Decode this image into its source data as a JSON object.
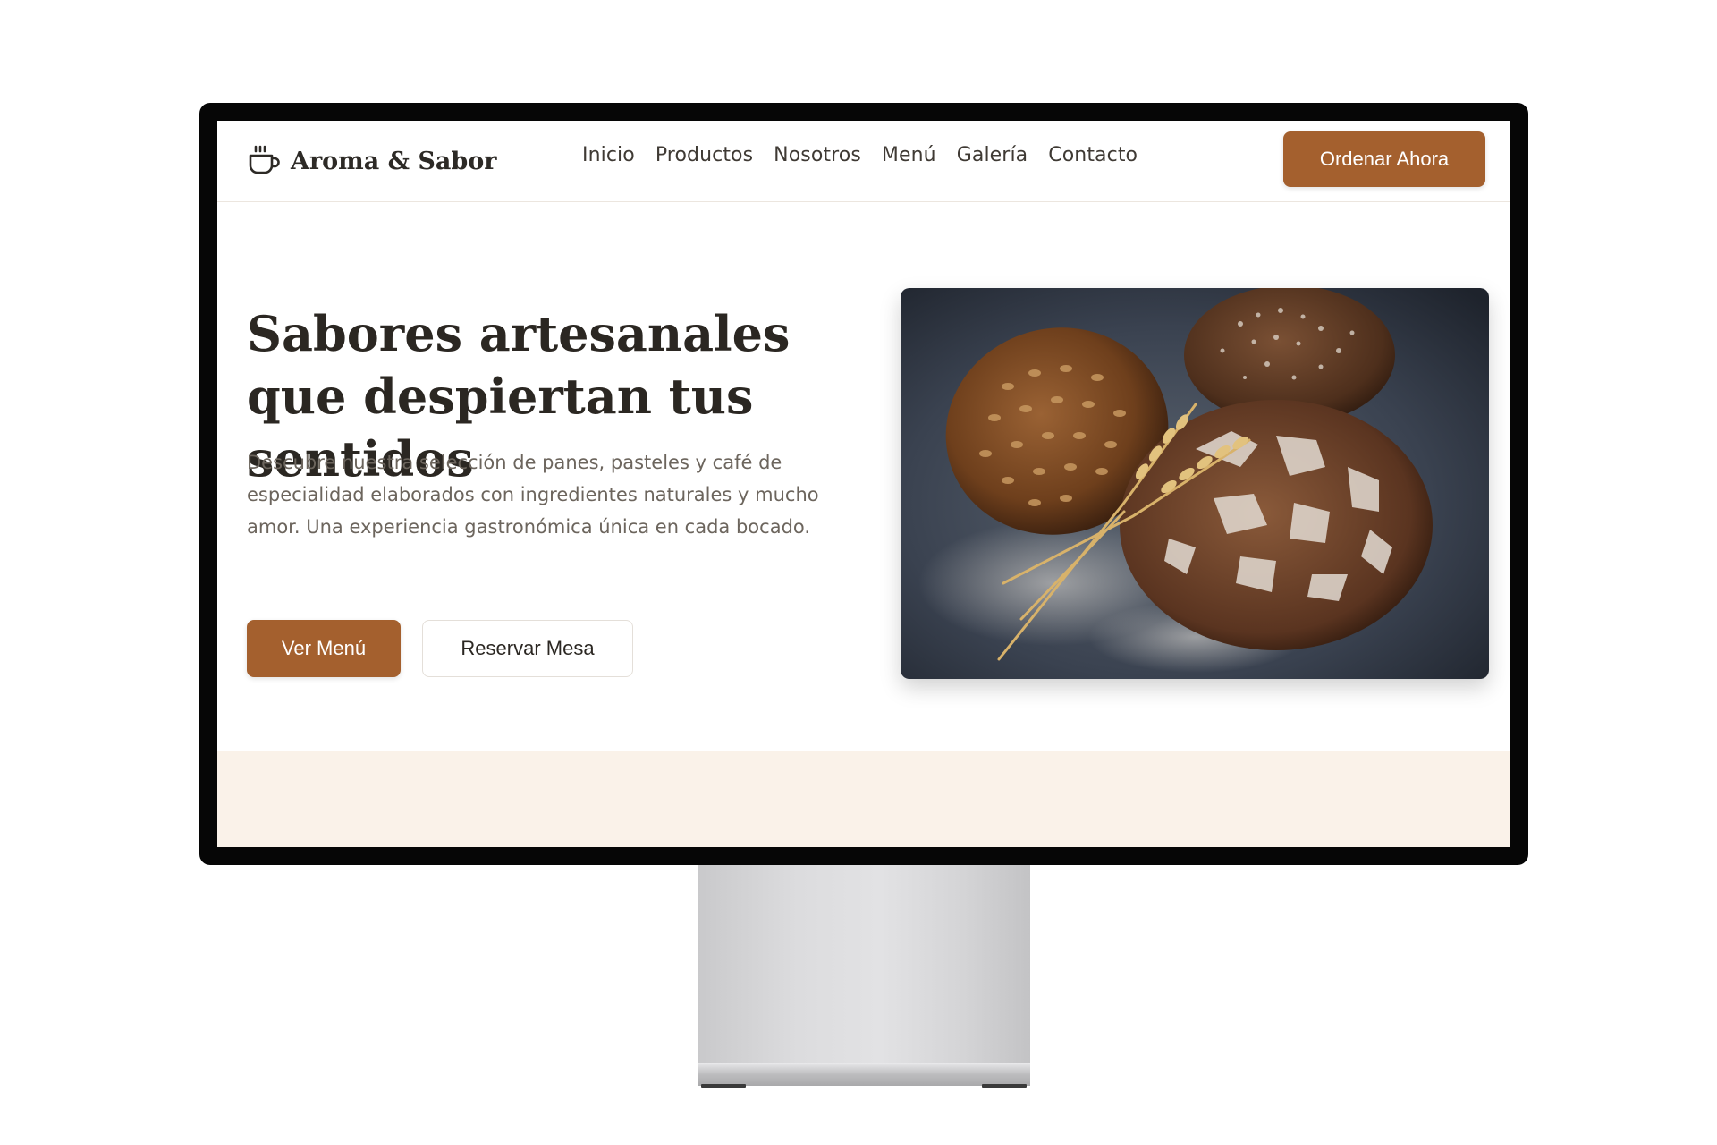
{
  "brand": {
    "name": "Aroma & Sabor",
    "icon": "coffee-cup-icon",
    "accent_color": "#a4602e",
    "band_color": "#faf2e9"
  },
  "nav": {
    "links": [
      "Inicio",
      "Productos",
      "Nosotros",
      "Menú",
      "Galería",
      "Contacto"
    ],
    "cta_label": "Ordenar Ahora"
  },
  "hero": {
    "title": "Sabores artesanales que despiertan tus sentidos",
    "description": "Descubre nuestra selección de panes, pasteles y café de especialidad elaborados con ingredientes naturales y mucho amor. Una experiencia gastronómica única en cada bocado.",
    "primary_button": "Ver Menú",
    "secondary_button": "Reservar Mesa",
    "image_subject": "rustic-bread-loaves-with-wheat"
  }
}
